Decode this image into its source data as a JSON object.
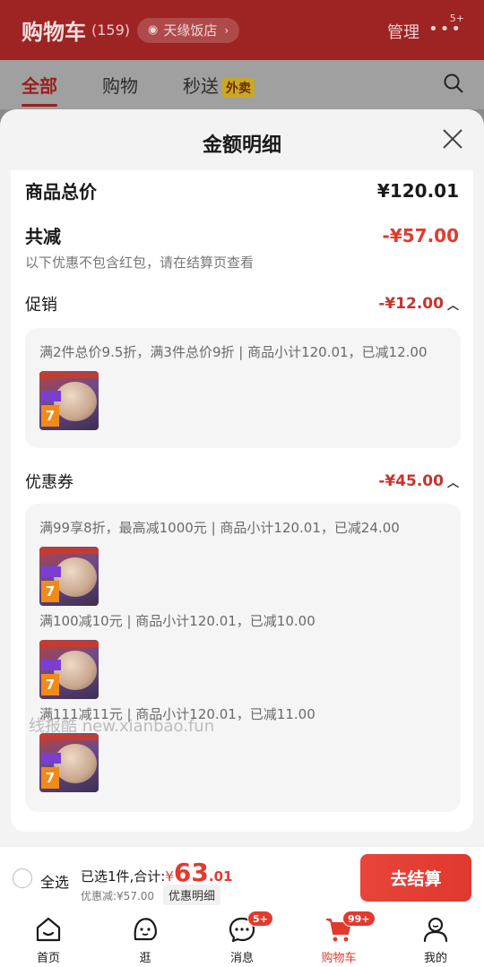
{
  "header": {
    "title": "购物车",
    "count": "(159)",
    "store": "天缘饭店",
    "manage": "管理",
    "more_badge": "5+"
  },
  "tabs": [
    {
      "label": "全部",
      "active": true
    },
    {
      "label": "购物"
    },
    {
      "label": "秒送",
      "badge": "外卖"
    }
  ],
  "sheet": {
    "title": "金额明细",
    "total_label": "商品总价",
    "total_value": "¥120.01",
    "reduce_label": "共减",
    "reduce_value": "-¥57.00",
    "note": "以下优惠不包含红包，请在结算页查看",
    "promo": {
      "label": "促销",
      "value": "-¥12.00",
      "rule": "满2件总价9.5折，满3件总价9折 | 商品小计120.01，已减12.00"
    },
    "coupon": {
      "label": "优惠券",
      "value": "-¥45.00",
      "rules": [
        "满99享8折，最高减1000元 | 商品小计120.01，已减24.00",
        "满100减10元 | 商品小计120.01，已减10.00",
        "满111减11元 | 商品小计120.01，已减11.00"
      ]
    },
    "thumb_seven": "7",
    "watermark": "线报酷 new.xianbao.fun"
  },
  "checkout": {
    "select_all": "全选",
    "summary_prefix": "已选1件,合计:",
    "yen": "¥",
    "amount_int": "63",
    "amount_dec": ".01",
    "discount": "优惠减:¥57.00",
    "detail_chip": "优惠明细",
    "pay_button": "去结算"
  },
  "nav": [
    {
      "label": "首页",
      "icon": "home-icon"
    },
    {
      "label": "逛",
      "icon": "browse-icon"
    },
    {
      "label": "消息",
      "icon": "message-icon",
      "badge": "5+"
    },
    {
      "label": "购物车",
      "icon": "cart-icon",
      "badge": "99+",
      "active": true
    },
    {
      "label": "我的",
      "icon": "profile-icon"
    }
  ],
  "colors": {
    "accent": "#e23a2e",
    "header_dim": "#9e2323"
  }
}
